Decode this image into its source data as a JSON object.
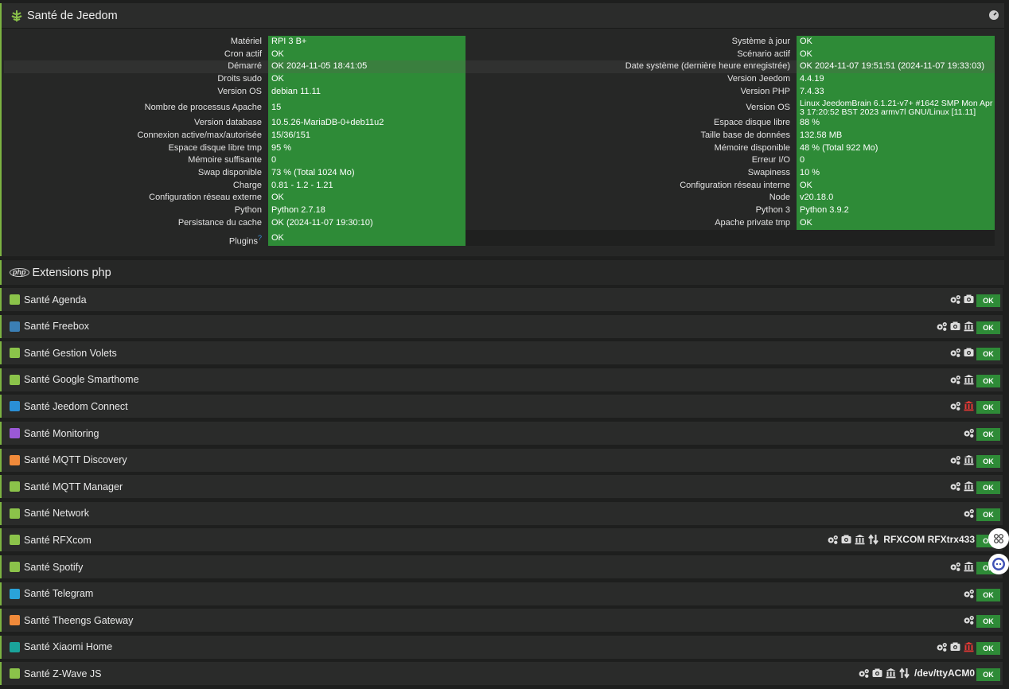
{
  "health": {
    "title": "Santé de Jeedom",
    "left": [
      {
        "label": "Matériel",
        "value": "RPI 3 B+"
      },
      {
        "label": "Cron actif",
        "value": "OK"
      },
      {
        "label": "Démarré",
        "value": "OK 2024-11-05 18:41:05"
      },
      {
        "label": "Droits sudo",
        "value": "OK"
      },
      {
        "label": "Version OS",
        "value": "debian 11.11"
      },
      {
        "label": "Nombre de processus Apache",
        "value": "15"
      },
      {
        "label": "Version database",
        "value": "10.5.26-MariaDB-0+deb11u2"
      },
      {
        "label": "Connexion active/max/autorisée",
        "value": "15/36/151"
      },
      {
        "label": "Espace disque libre tmp",
        "value": "95 %"
      },
      {
        "label": "Mémoire suffisante",
        "value": "0"
      },
      {
        "label": "Swap disponible",
        "value": "73 % (Total 1024 Mo)"
      },
      {
        "label": "Charge",
        "value": "0.81 - 1.2 - 1.21"
      },
      {
        "label": "Configuration réseau externe",
        "value": "OK"
      },
      {
        "label": "Python",
        "value": "Python 2.7.18"
      },
      {
        "label": "Persistance du cache",
        "value": "OK (2024-11-07 19:30:10)"
      },
      {
        "label": "Plugins",
        "value": "OK"
      }
    ],
    "right": [
      {
        "label": "Système à jour",
        "value": "OK"
      },
      {
        "label": "Scénario actif",
        "value": "OK"
      },
      {
        "label": "Date système (dernière heure enregistrée)",
        "value": "OK 2024-11-07 19:51:51 (2024-11-07 19:33:03)"
      },
      {
        "label": "Version Jeedom",
        "value": "4.4.19"
      },
      {
        "label": "Version PHP",
        "value": "7.4.33"
      },
      {
        "label": "Version OS",
        "value": "Linux JeedomBrain 6.1.21-v7+ #1642 SMP Mon Apr 3 17:20:52 BST 2023 armv7l GNU/Linux [11.11]"
      },
      {
        "label": "Espace disque libre",
        "value": "88 %"
      },
      {
        "label": "Taille base de données",
        "value": "132.58 MB"
      },
      {
        "label": "Mémoire disponible",
        "value": "48 % (Total 922 Mo)"
      },
      {
        "label": "Erreur I/O",
        "value": "0"
      },
      {
        "label": "Swapiness",
        "value": "10 %"
      },
      {
        "label": "Configuration réseau interne",
        "value": "OK"
      },
      {
        "label": "Node",
        "value": "v20.18.0"
      },
      {
        "label": "Python 3",
        "value": "Python 3.9.2"
      },
      {
        "label": "Apache private tmp",
        "value": "OK"
      }
    ]
  },
  "extensions": {
    "title": "Extensions php",
    "php_badge": "php"
  },
  "plugins": [
    {
      "name": "Santé Agenda",
      "color": "#8bc34a",
      "tools": [
        "gears",
        "camera"
      ],
      "extra": "",
      "status": "OK"
    },
    {
      "name": "Santé Freebox",
      "color": "#3b7fb5",
      "tools": [
        "gears",
        "camera",
        "bank"
      ],
      "extra": "",
      "status": "OK"
    },
    {
      "name": "Santé Gestion Volets",
      "color": "#8bc34a",
      "tools": [
        "gears",
        "camera"
      ],
      "extra": "",
      "status": "OK"
    },
    {
      "name": "Santé Google Smarthome",
      "color": "#8bc34a",
      "tools": [
        "gears",
        "bank"
      ],
      "extra": "",
      "status": "OK"
    },
    {
      "name": "Santé Jeedom Connect",
      "color": "#2a8fd6",
      "tools": [
        "gears",
        "bank-red"
      ],
      "extra": "",
      "status": "OK"
    },
    {
      "name": "Santé Monitoring",
      "color": "#9b59d6",
      "tools": [
        "gears"
      ],
      "extra": "",
      "status": "OK"
    },
    {
      "name": "Santé MQTT Discovery",
      "color": "#f08a3a",
      "tools": [
        "gears",
        "bank"
      ],
      "extra": "",
      "status": "OK"
    },
    {
      "name": "Santé MQTT Manager",
      "color": "#8bc34a",
      "tools": [
        "gears",
        "bank"
      ],
      "extra": "",
      "status": "OK"
    },
    {
      "name": "Santé Network",
      "color": "#8bc34a",
      "tools": [
        "gears"
      ],
      "extra": "",
      "status": "OK"
    },
    {
      "name": "Santé RFXcom",
      "color": "#8bc34a",
      "tools": [
        "gears",
        "camera",
        "bank",
        "arrows"
      ],
      "extra": "RFXCOM RFXtrx433",
      "status": "OK"
    },
    {
      "name": "Santé Spotify",
      "color": "#8bc34a",
      "tools": [
        "gears",
        "bank"
      ],
      "extra": "",
      "status": "OK"
    },
    {
      "name": "Santé Telegram",
      "color": "#2aa3d9",
      "tools": [
        "gears"
      ],
      "extra": "",
      "status": "OK"
    },
    {
      "name": "Santé Theengs Gateway",
      "color": "#f08a3a",
      "tools": [
        "gears"
      ],
      "extra": "",
      "status": "OK"
    },
    {
      "name": "Santé Xiaomi Home",
      "color": "#1aa39a",
      "tools": [
        "gears",
        "camera",
        "bank-red"
      ],
      "extra": "",
      "status": "OK"
    },
    {
      "name": "Santé Z-Wave JS",
      "color": "#8bc34a",
      "tools": [
        "gears",
        "camera",
        "bank",
        "arrows"
      ],
      "extra": "/dev/ttyACM0",
      "status": "OK"
    }
  ]
}
